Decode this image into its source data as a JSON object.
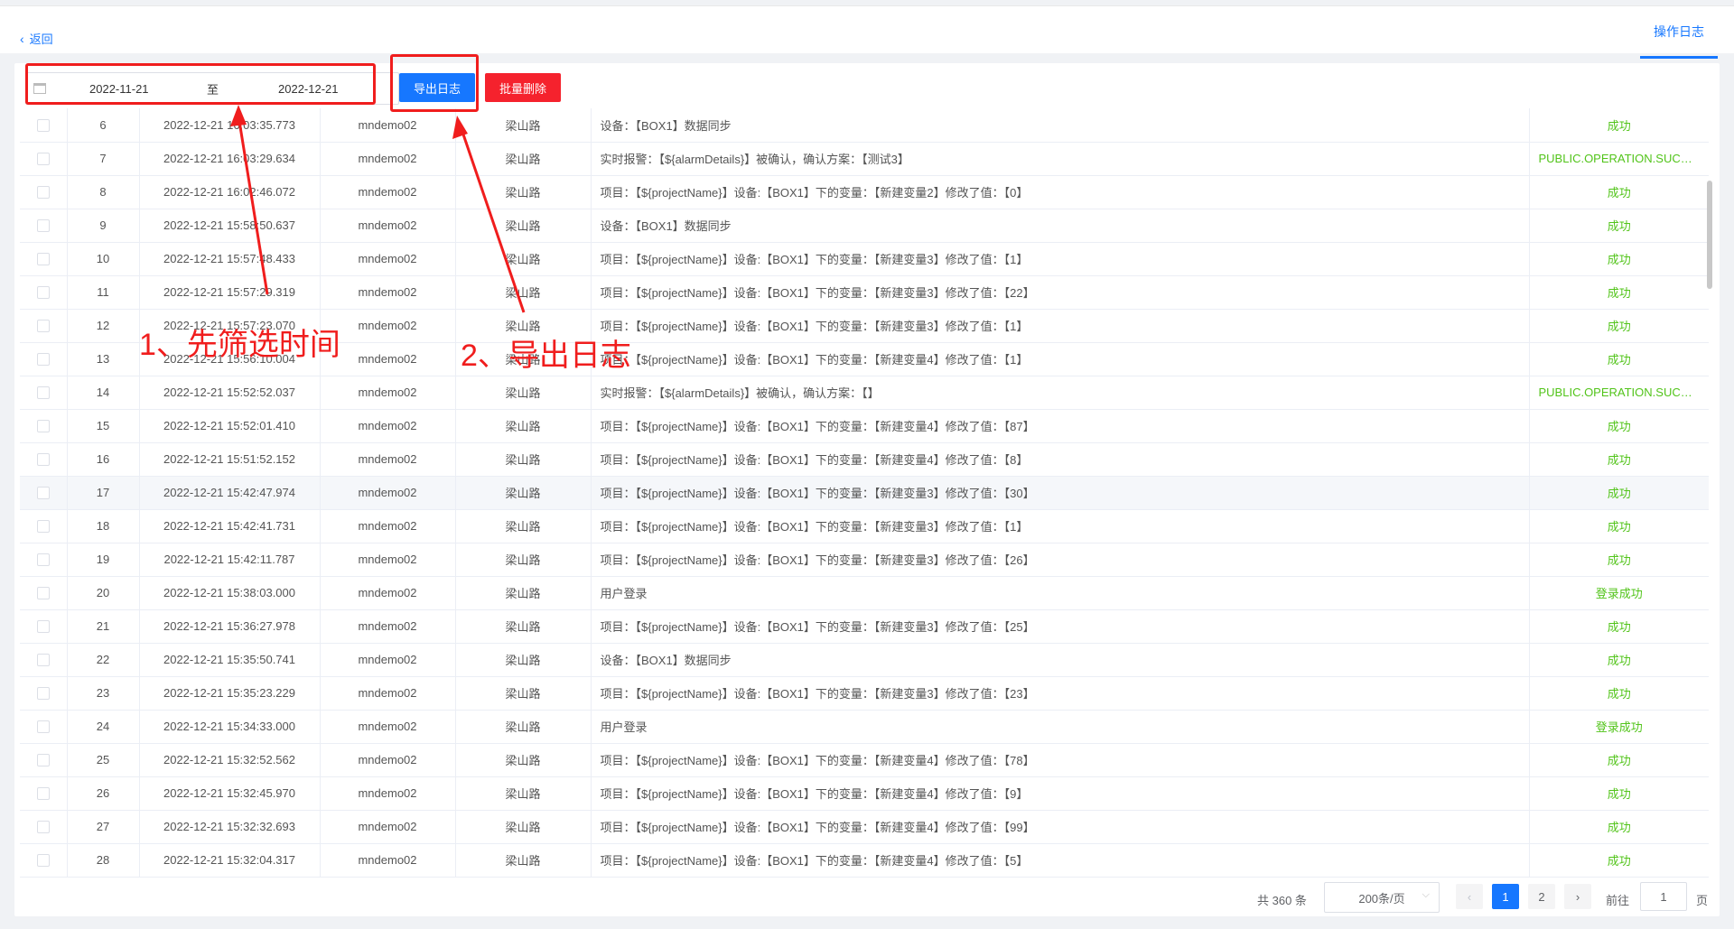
{
  "header": {
    "back_label": "返回",
    "active_tab": "操作日志"
  },
  "toolbar": {
    "date_start": "2022-11-21",
    "date_separator": "至",
    "date_end": "2022-12-21",
    "export_label": "导出日志",
    "batch_delete_label": "批量删除"
  },
  "table": {
    "rows": [
      {
        "num": "6",
        "time": "2022-12-21 16:03:35.773",
        "user": "mndemo02",
        "location": "梁山路",
        "detail": "设备：【BOX1】数据同步",
        "result": "成功"
      },
      {
        "num": "7",
        "time": "2022-12-21 16:03:29.634",
        "user": "mndemo02",
        "location": "梁山路",
        "detail": "实时报警：【${alarmDetails}】被确认，确认方案：【测试3】",
        "result": "PUBLIC.OPERATION.SUCCESS"
      },
      {
        "num": "8",
        "time": "2022-12-21 16:02:46.072",
        "user": "mndemo02",
        "location": "梁山路",
        "detail": "项目：【${projectName}】设备:【BOX1】下的变量：【新建变量2】修改了值：【0】",
        "result": "成功"
      },
      {
        "num": "9",
        "time": "2022-12-21 15:58:50.637",
        "user": "mndemo02",
        "location": "梁山路",
        "detail": "设备：【BOX1】数据同步",
        "result": "成功"
      },
      {
        "num": "10",
        "time": "2022-12-21 15:57:48.433",
        "user": "mndemo02",
        "location": "梁山路",
        "detail": "项目：【${projectName}】设备:【BOX1】下的变量：【新建变量3】修改了值：【1】",
        "result": "成功"
      },
      {
        "num": "11",
        "time": "2022-12-21 15:57:29.319",
        "user": "mndemo02",
        "location": "梁山路",
        "detail": "项目：【${projectName}】设备:【BOX1】下的变量：【新建变量3】修改了值：【22】",
        "result": "成功"
      },
      {
        "num": "12",
        "time": "2022-12-21 15:57:23.070",
        "user": "mndemo02",
        "location": "梁山路",
        "detail": "项目：【${projectName}】设备:【BOX1】下的变量：【新建变量3】修改了值：【1】",
        "result": "成功"
      },
      {
        "num": "13",
        "time": "2022-12-21 15:56:10.004",
        "user": "mndemo02",
        "location": "梁山路",
        "detail": "项目：【${projectName}】设备:【BOX1】下的变量：【新建变量4】修改了值：【1】",
        "result": "成功"
      },
      {
        "num": "14",
        "time": "2022-12-21 15:52:52.037",
        "user": "mndemo02",
        "location": "梁山路",
        "detail": "实时报警：【${alarmDetails}】被确认，确认方案：【】",
        "result": "PUBLIC.OPERATION.SUCCESS"
      },
      {
        "num": "15",
        "time": "2022-12-21 15:52:01.410",
        "user": "mndemo02",
        "location": "梁山路",
        "detail": "项目：【${projectName}】设备:【BOX1】下的变量：【新建变量4】修改了值：【87】",
        "result": "成功"
      },
      {
        "num": "16",
        "time": "2022-12-21 15:51:52.152",
        "user": "mndemo02",
        "location": "梁山路",
        "detail": "项目：【${projectName}】设备:【BOX1】下的变量：【新建变量4】修改了值：【8】",
        "result": "成功"
      },
      {
        "num": "17",
        "time": "2022-12-21 15:42:47.974",
        "user": "mndemo02",
        "location": "梁山路",
        "detail": "项目：【${projectName}】设备:【BOX1】下的变量：【新建变量3】修改了值：【30】",
        "result": "成功"
      },
      {
        "num": "18",
        "time": "2022-12-21 15:42:41.731",
        "user": "mndemo02",
        "location": "梁山路",
        "detail": "项目：【${projectName}】设备:【BOX1】下的变量：【新建变量3】修改了值：【1】",
        "result": "成功"
      },
      {
        "num": "19",
        "time": "2022-12-21 15:42:11.787",
        "user": "mndemo02",
        "location": "梁山路",
        "detail": "项目：【${projectName}】设备:【BOX1】下的变量：【新建变量3】修改了值：【26】",
        "result": "成功"
      },
      {
        "num": "20",
        "time": "2022-12-21 15:38:03.000",
        "user": "mndemo02",
        "location": "梁山路",
        "detail": "用户登录",
        "result": "登录成功"
      },
      {
        "num": "21",
        "time": "2022-12-21 15:36:27.978",
        "user": "mndemo02",
        "location": "梁山路",
        "detail": "项目：【${projectName}】设备:【BOX1】下的变量：【新建变量3】修改了值：【25】",
        "result": "成功"
      },
      {
        "num": "22",
        "time": "2022-12-21 15:35:50.741",
        "user": "mndemo02",
        "location": "梁山路",
        "detail": "设备：【BOX1】数据同步",
        "result": "成功"
      },
      {
        "num": "23",
        "time": "2022-12-21 15:35:23.229",
        "user": "mndemo02",
        "location": "梁山路",
        "detail": "项目：【${projectName}】设备:【BOX1】下的变量：【新建变量3】修改了值：【23】",
        "result": "成功"
      },
      {
        "num": "24",
        "time": "2022-12-21 15:34:33.000",
        "user": "mndemo02",
        "location": "梁山路",
        "detail": "用户登录",
        "result": "登录成功"
      },
      {
        "num": "25",
        "time": "2022-12-21 15:32:52.562",
        "user": "mndemo02",
        "location": "梁山路",
        "detail": "项目：【${projectName}】设备:【BOX1】下的变量：【新建变量4】修改了值：【78】",
        "result": "成功"
      },
      {
        "num": "26",
        "time": "2022-12-21 15:32:45.970",
        "user": "mndemo02",
        "location": "梁山路",
        "detail": "项目：【${projectName}】设备:【BOX1】下的变量：【新建变量4】修改了值：【9】",
        "result": "成功"
      },
      {
        "num": "27",
        "time": "2022-12-21 15:32:32.693",
        "user": "mndemo02",
        "location": "梁山路",
        "detail": "项目：【${projectName}】设备:【BOX1】下的变量：【新建变量4】修改了值：【99】",
        "result": "成功"
      },
      {
        "num": "28",
        "time": "2022-12-21 15:32:04.317",
        "user": "mndemo02",
        "location": "梁山路",
        "detail": "项目：【${projectName}】设备:【BOX1】下的变量：【新建变量4】修改了值：【5】",
        "result": "成功"
      }
    ]
  },
  "pagination": {
    "total_label": "共 360 条",
    "page_size_label": "200条/页",
    "pages": [
      "1",
      "2"
    ],
    "current_page": "1",
    "goto_label": "前往",
    "goto_value": "1",
    "page_suffix": "页"
  },
  "annotations": {
    "step1": "1、先筛选时间",
    "step2": "2、导出日志"
  },
  "colors": {
    "primary": "#1677ff",
    "danger": "#f5222d",
    "success": "#52c41a",
    "annotation": "#f01d1d"
  }
}
